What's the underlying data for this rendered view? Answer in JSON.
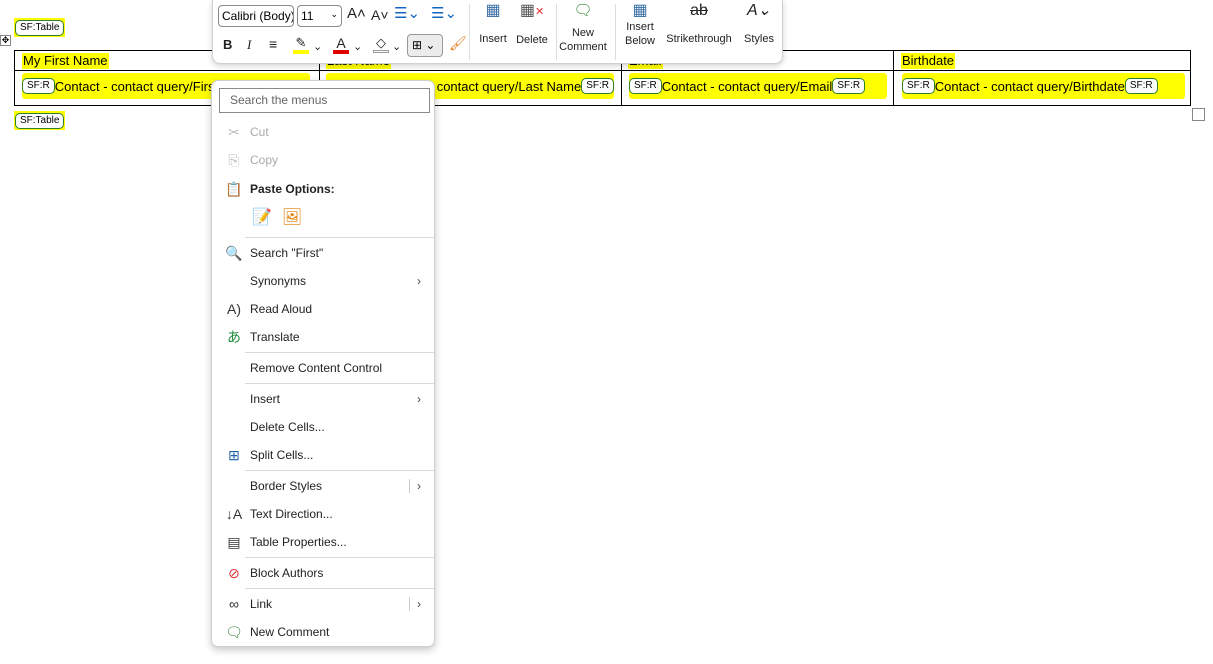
{
  "document": {
    "table_start_tag": "SF:Table",
    "table_end_tag": "SF:Table",
    "headers": [
      "My First Name",
      "Last Name",
      "Email",
      "Birthdate"
    ],
    "row_tag": "SF:R",
    "cells": [
      "Contact - contact query/First Name",
      "Contact - contact query/Last Name",
      "Contact - contact query/Email",
      "Contact - contact query/Birthdate"
    ]
  },
  "toolbar": {
    "font_name": "Calibri (Body)",
    "font_size": "11",
    "insert_label": "Insert",
    "delete_label": "Delete",
    "new_comment_label": "New Comment",
    "insert_below_label": "Insert Below",
    "strikethrough_label": "Strikethrough",
    "styles_label": "Styles",
    "highlight_color": "#ffff00",
    "font_color": "#e00000"
  },
  "menu": {
    "search_placeholder": "Search the menus",
    "items": [
      {
        "label": "Cut",
        "icon": "scissors-icon",
        "disabled": true
      },
      {
        "label": "Copy",
        "icon": "copy-icon",
        "disabled": true
      },
      {
        "label": "Paste Options:",
        "icon": "paste-icon",
        "bold": true
      },
      {
        "label": "Search \"First\"",
        "icon": "search-icon"
      },
      {
        "label": "Synonyms",
        "submenu": true
      },
      {
        "label": "Read Aloud",
        "icon": "read-aloud-icon"
      },
      {
        "label": "Translate",
        "icon": "translate-icon"
      },
      {
        "label": "Remove Content Control"
      },
      {
        "label": "Insert",
        "submenu": true
      },
      {
        "label": "Delete Cells..."
      },
      {
        "label": "Split Cells...",
        "icon": "split-cells-icon"
      },
      {
        "label": "Border Styles",
        "submenu": true,
        "split": true
      },
      {
        "label": "Text Direction...",
        "icon": "text-direction-icon"
      },
      {
        "label": "Table Properties...",
        "icon": "table-properties-icon"
      },
      {
        "label": "Block Authors",
        "icon": "block-authors-icon"
      },
      {
        "label": "Link",
        "icon": "link-icon",
        "submenu": true,
        "split": true
      },
      {
        "label": "New Comment",
        "icon": "new-comment-icon"
      }
    ]
  }
}
